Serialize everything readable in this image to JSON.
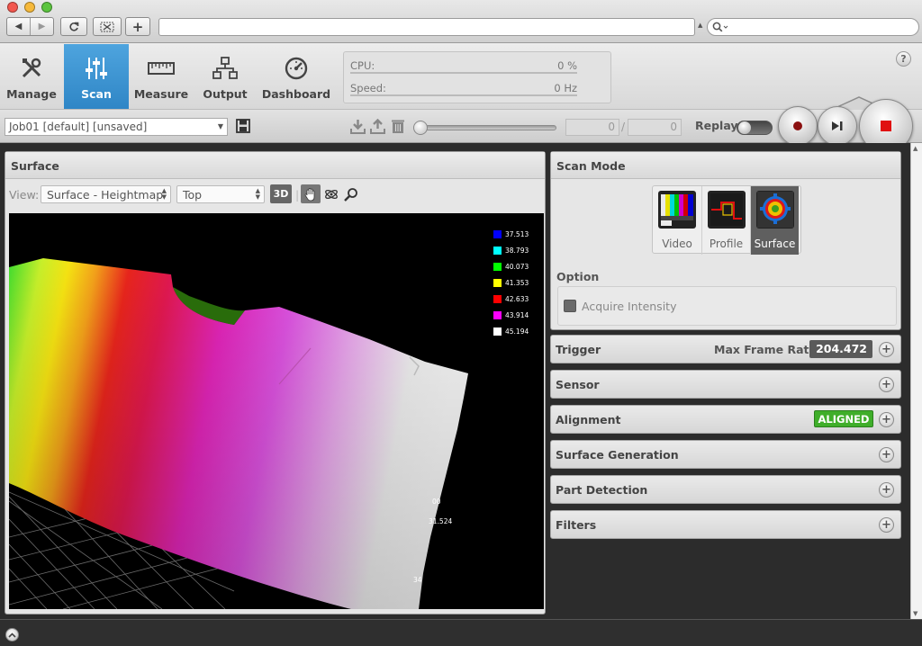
{
  "browser": {
    "search_placeholder": ""
  },
  "nav": {
    "tabs": [
      {
        "label": "Manage",
        "icon": "tools-icon"
      },
      {
        "label": "Scan",
        "icon": "sliders-icon"
      },
      {
        "label": "Measure",
        "icon": "ruler-icon"
      },
      {
        "label": "Output",
        "icon": "network-icon"
      },
      {
        "label": "Dashboard",
        "icon": "gauge-icon"
      }
    ],
    "active_tab": "Scan"
  },
  "stats": {
    "cpu_label": "CPU:",
    "cpu_value": "0 %",
    "speed_label": "Speed:",
    "speed_value": "0 Hz"
  },
  "help_label": "?",
  "job": {
    "name": "Job01 [default] [unsaved]",
    "frame_current": "0",
    "frame_separator": "/",
    "frame_total": "0",
    "replay_label": "Replay"
  },
  "surface_panel": {
    "title": "Surface",
    "view_label": "View:",
    "view_mode": "Surface - Heightmap",
    "view_angle": "Top",
    "btn_3d": "3D"
  },
  "legend": {
    "items": [
      {
        "value": "37.513",
        "color": "#0000ff"
      },
      {
        "value": "38.793",
        "color": "#00ffff"
      },
      {
        "value": "40.073",
        "color": "#00ff00"
      },
      {
        "value": "41.353",
        "color": "#ffff00"
      },
      {
        "value": "42.633",
        "color": "#ff0000"
      },
      {
        "value": "43.914",
        "color": "#ff00ff"
      },
      {
        "value": "45.194",
        "color": "#ffffff"
      }
    ],
    "grid_labels": [
      "00",
      "31.524",
      "34"
    ]
  },
  "scan_mode": {
    "title": "Scan Mode",
    "modes": [
      "Video",
      "Profile",
      "Surface"
    ],
    "selected": "Surface",
    "option_title": "Option",
    "acquire_intensity": "Acquire Intensity"
  },
  "sections": {
    "trigger": "Trigger",
    "max_frame_rate_label": "Max Frame Rate:",
    "max_frame_rate_value": "204.472",
    "sensor": "Sensor",
    "alignment": "Alignment",
    "alignment_status": "ALIGNED",
    "surface_generation": "Surface Generation",
    "part_detection": "Part Detection",
    "filters": "Filters"
  },
  "colors": {
    "accent": "#3a93d4",
    "aligned_green": "#3fae2a"
  }
}
